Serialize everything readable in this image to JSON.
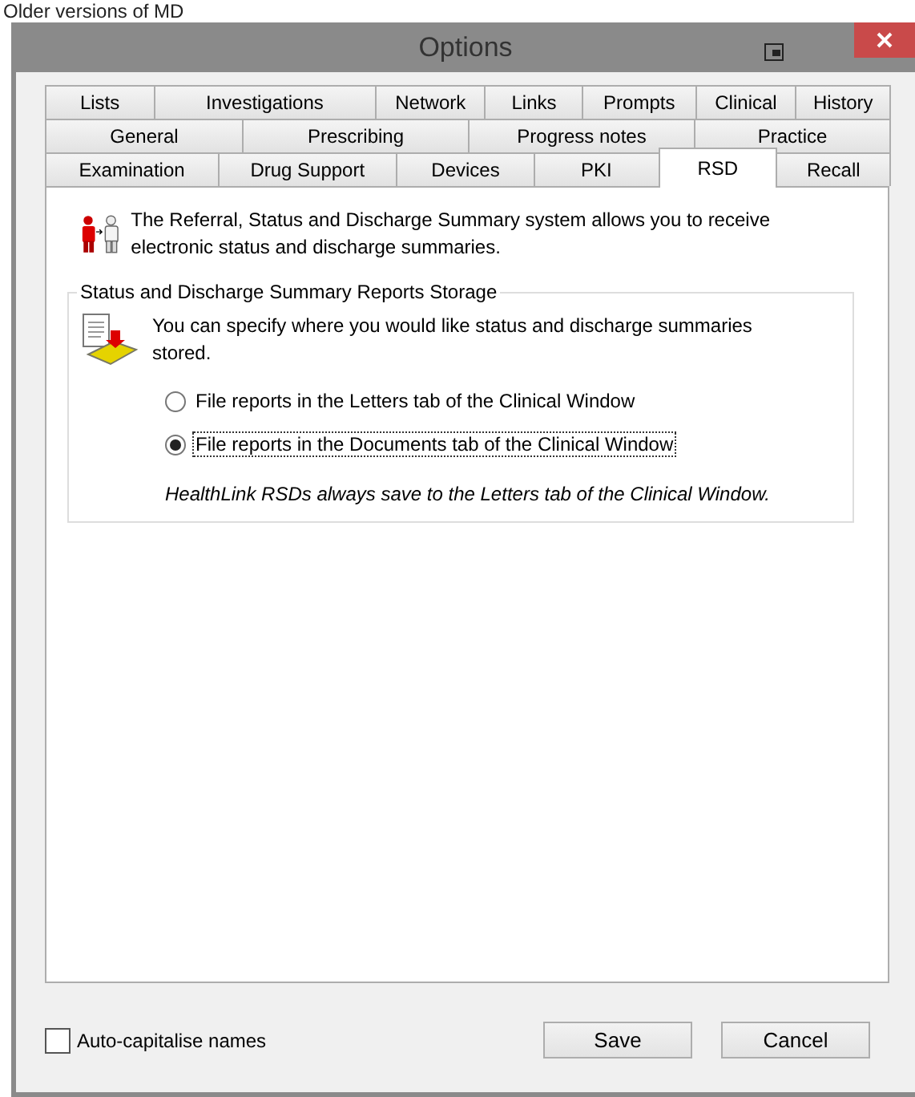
{
  "caption": "Older versions of MD",
  "window": {
    "title": "Options"
  },
  "tab_rows": [
    [
      {
        "label": "Lists",
        "selected": false
      },
      {
        "label": "Investigations",
        "selected": false
      },
      {
        "label": "Network",
        "selected": false
      },
      {
        "label": "Links",
        "selected": false
      },
      {
        "label": "Prompts",
        "selected": false
      },
      {
        "label": "Clinical",
        "selected": false
      },
      {
        "label": "History",
        "selected": false
      }
    ],
    [
      {
        "label": "General",
        "selected": false
      },
      {
        "label": "Prescribing",
        "selected": false
      },
      {
        "label": "Progress notes",
        "selected": false
      },
      {
        "label": "Practice",
        "selected": false
      }
    ],
    [
      {
        "label": "Examination",
        "selected": false
      },
      {
        "label": "Drug Support",
        "selected": false
      },
      {
        "label": "Devices",
        "selected": false
      },
      {
        "label": "PKI",
        "selected": false
      },
      {
        "label": "RSD",
        "selected": true
      },
      {
        "label": "Recall",
        "selected": false
      }
    ]
  ],
  "intro": "The Referral, Status and Discharge Summary system allows you to receive electronic status and discharge summaries.",
  "group": {
    "title": "Status and Discharge Summary Reports Storage",
    "description": "You can specify where you would like status and discharge summaries stored.",
    "options": [
      {
        "label": "File reports in the Letters tab of the Clinical Window",
        "selected": false
      },
      {
        "label": "File reports in the Documents tab of the Clinical Window",
        "selected": true
      }
    ],
    "note": "HealthLink RSDs always save to the Letters tab of the Clinical Window."
  },
  "auto_capitalise": {
    "label": "Auto-capitalise names",
    "checked": false
  },
  "buttons": [
    "Save",
    "Cancel"
  ]
}
